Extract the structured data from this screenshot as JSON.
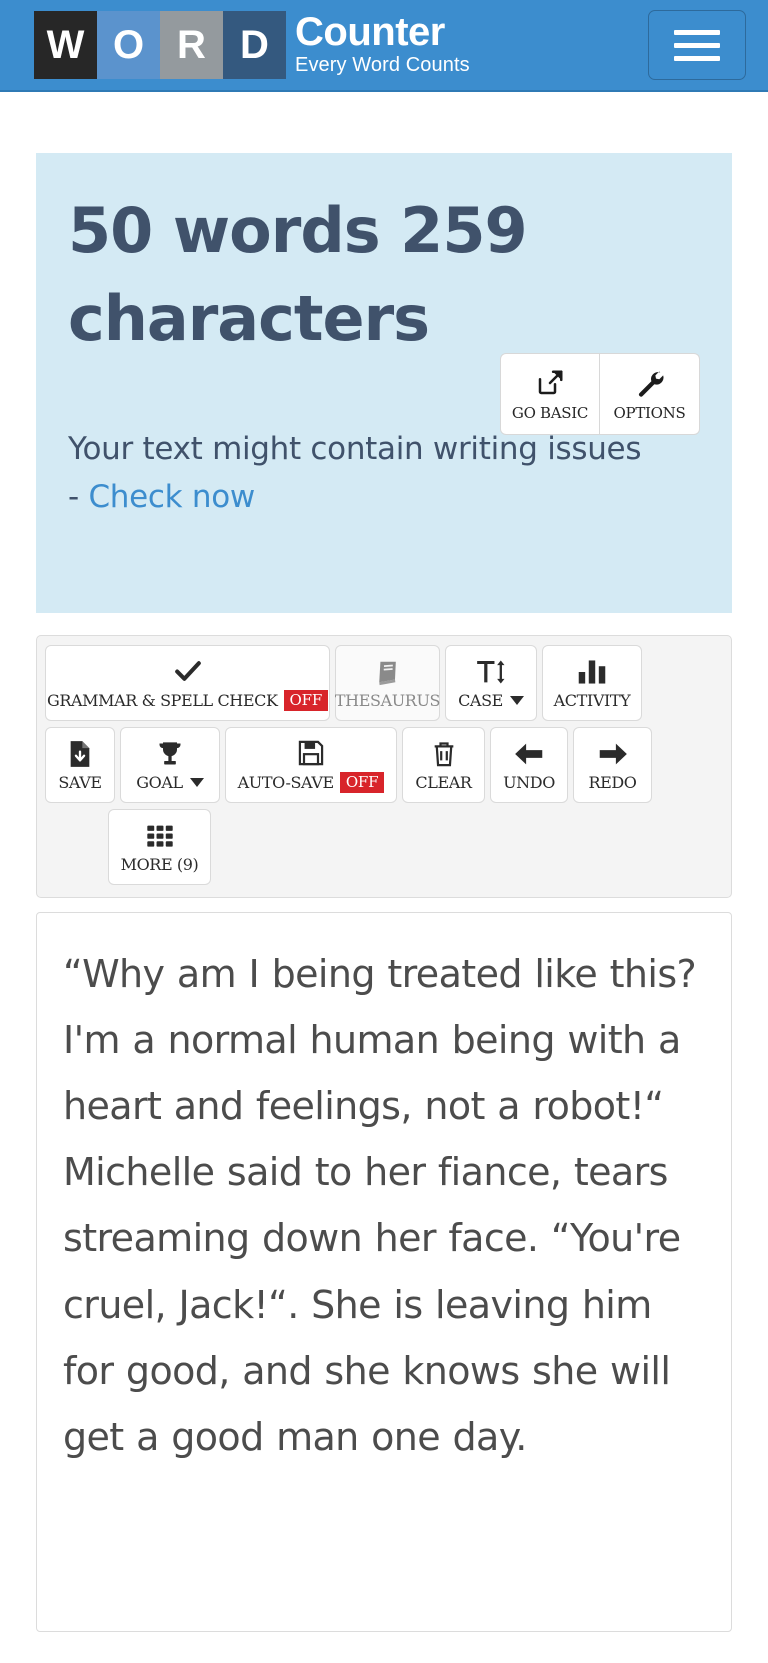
{
  "header": {
    "logo_tiles": [
      "W",
      "O",
      "R",
      "D"
    ],
    "brand_main": "Counter",
    "brand_sub": "Every Word Counts",
    "menu_label": "menu-toggle",
    "colors": {
      "bar": "#3c8dce",
      "tile_w": "#272727",
      "tile_o": "#5b93cd",
      "tile_r": "#949a9e",
      "tile_d": "#34597f"
    }
  },
  "stats": {
    "word_count": 50,
    "character_count": 259,
    "heading": "50 words 259 characters",
    "panel_color": "#d4eaf4",
    "heading_color": "#40526b",
    "buttons": [
      {
        "label": "GO BASIC",
        "icon": "external-link-icon"
      },
      {
        "label": "OPTIONS",
        "icon": "wrench-icon"
      }
    ],
    "issues_text": "Your text might contain writing issues",
    "issues_dash": "-",
    "issues_link": "Check now",
    "link_color": "#3c8dce"
  },
  "toolbar": {
    "row1": [
      {
        "label": "GRAMMAR & SPELL CHECK",
        "icon": "check-icon",
        "badge": "OFF",
        "badge_color": "#d8242a",
        "muted": false
      },
      {
        "label": "THESAURUS",
        "icon": "book-icon",
        "badge": "",
        "muted": true
      },
      {
        "label": "CASE",
        "icon": "text-size-icon",
        "badge": "",
        "caret": true,
        "muted": false
      },
      {
        "label": "ACTIVITY",
        "icon": "bar-chart-icon",
        "badge": "",
        "muted": false
      }
    ],
    "row2": [
      {
        "label": "SAVE",
        "icon": "file-download-icon",
        "badge": "",
        "muted": false
      },
      {
        "label": "GOAL",
        "icon": "trophy-icon",
        "badge": "",
        "caret": true,
        "muted": false
      },
      {
        "label": "AUTO-SAVE",
        "icon": "floppy-disk-icon",
        "badge": "OFF",
        "badge_color": "#d8242a",
        "muted": false
      },
      {
        "label": "CLEAR",
        "icon": "trash-icon",
        "badge": "",
        "muted": false
      },
      {
        "label": "UNDO",
        "icon": "arrow-left-icon",
        "badge": "",
        "muted": false
      },
      {
        "label": "REDO",
        "icon": "arrow-right-icon",
        "badge": "",
        "muted": false
      }
    ],
    "row3": [
      {
        "label": "MORE (9)",
        "icon": "grid-icon",
        "badge": "",
        "muted": false
      }
    ]
  },
  "editor": {
    "text": "“Why am I being treated like this? I'm a normal human being with a heart and feelings, not a robot!“ Michelle said to her fiance, tears streaming down her face. “You're cruel, Jack!“. She is leaving him for good, and she knows she will get a good man one day."
  }
}
